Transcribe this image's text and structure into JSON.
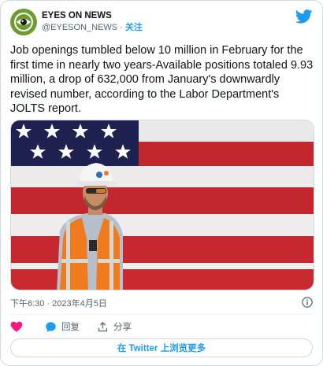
{
  "account": {
    "display_name": "EYES ON NEWS",
    "handle": "@EYESON_NEWS",
    "separator": "·",
    "follow_label": "关注"
  },
  "tweet": {
    "text": "Job openings tumbled below 10 million in February for the first time in nearly two years-Available positions totaled 9.93 million, a drop of 632,000 from January's downwardly revised number, according to the Labor Department's JOLTS report.",
    "timestamp": "下午6:30 · 2023年4月5日"
  },
  "actions": {
    "reply_label": "回复",
    "share_label": "分享"
  },
  "more_button_label": "在 Twitter 上浏览更多",
  "icons": {
    "twitter_bird": "twitter-bird-icon",
    "info": "info-icon",
    "like": "heart-icon",
    "reply": "reply-icon",
    "share": "share-icon"
  },
  "colors": {
    "accent": "#1d9bf0",
    "like": "#f91880",
    "avatar": "#6f9a2e"
  }
}
